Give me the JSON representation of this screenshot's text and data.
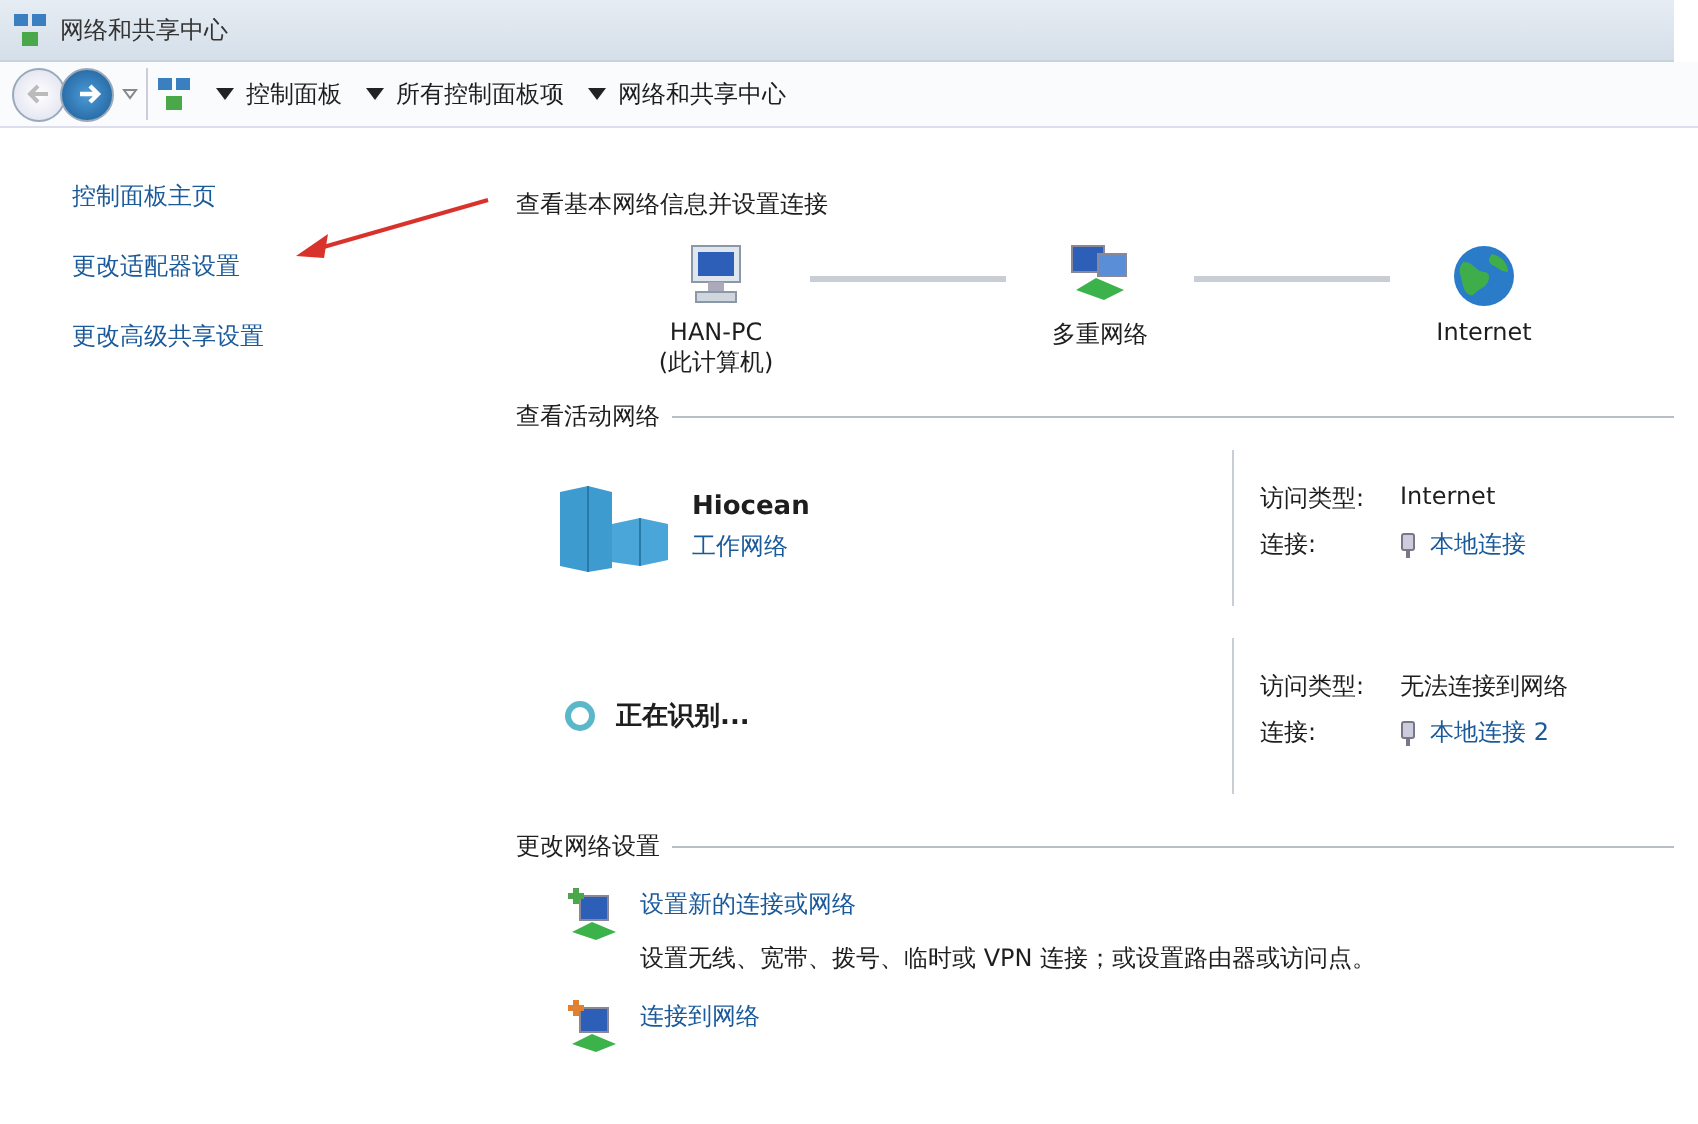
{
  "window": {
    "title": "网络和共享中心"
  },
  "breadcrumb": [
    "控制面板",
    "所有控制面板项",
    "网络和共享中心"
  ],
  "sidebar": {
    "items": [
      "控制面板主页",
      "更改适配器设置",
      "更改高级共享设置"
    ]
  },
  "network_map": {
    "heading": "查看基本网络信息并设置连接",
    "nodes": [
      {
        "kind": "computer",
        "label": "HAN-PC",
        "sublabel": "(此计算机)"
      },
      {
        "kind": "network",
        "label": "多重网络"
      },
      {
        "kind": "globe",
        "label": "Internet"
      }
    ]
  },
  "active_networks": {
    "heading": "查看活动网络",
    "networks": [
      {
        "kind": "building",
        "name": "Hiocean",
        "type_link": "工作网络",
        "access_label": "访问类型:",
        "access_value": "Internet",
        "connection_label": "连接:",
        "connection_link": "本地连接"
      },
      {
        "kind": "identifying",
        "name": "正在识别...",
        "access_label": "访问类型:",
        "access_value": "无法连接到网络",
        "connection_label": "连接:",
        "connection_link": "本地连接 2"
      }
    ]
  },
  "change_settings": {
    "heading": "更改网络设置",
    "tasks": [
      {
        "kind": "new",
        "title": "设置新的连接或网络",
        "description": "设置无线、宽带、拨号、临时或 VPN 连接；或设置路由器或访问点。"
      },
      {
        "kind": "connect",
        "title": "连接到网络"
      }
    ]
  }
}
